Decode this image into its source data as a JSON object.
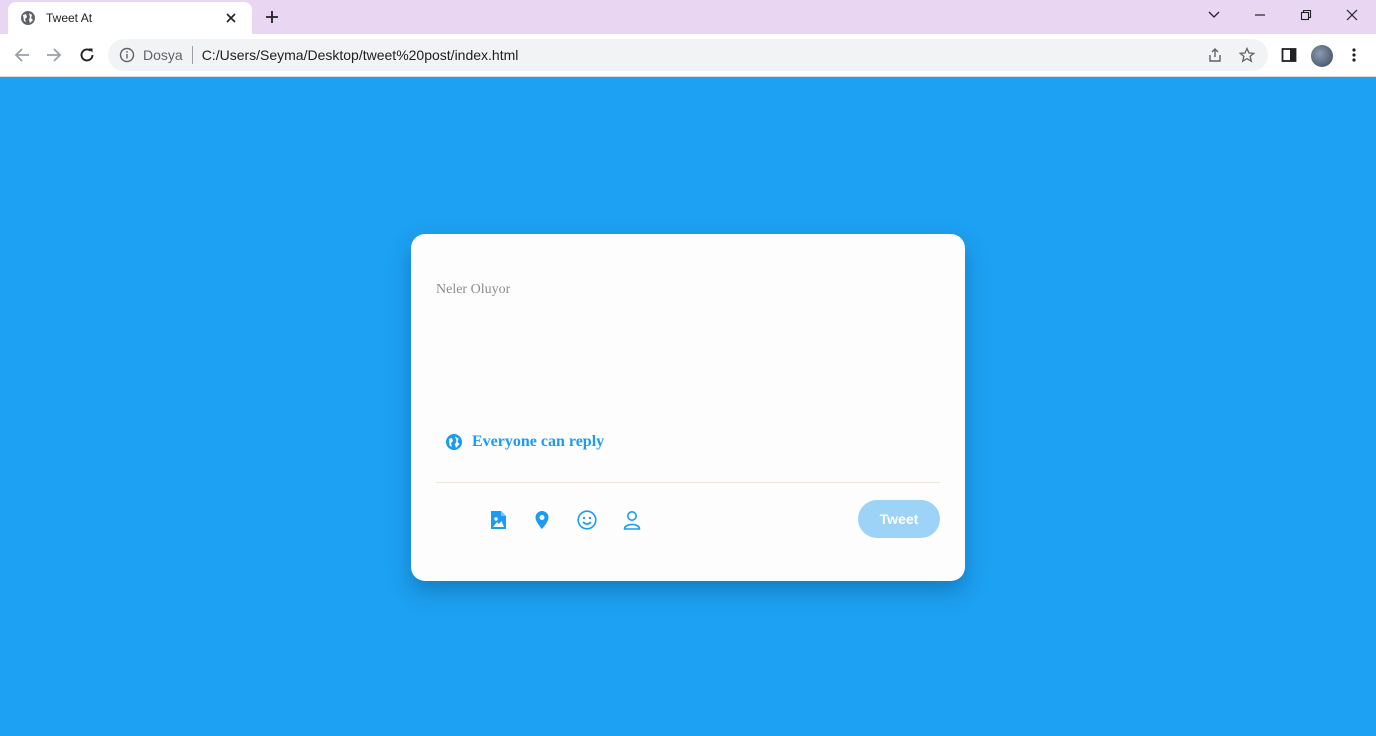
{
  "browser": {
    "tab_title": "Tweet At",
    "scheme_label": "Dosya",
    "url": "C:/Users/Seyma/Desktop/tweet%20post/index.html"
  },
  "composer": {
    "placeholder": "Neler Oluyor",
    "reply_setting": "Everyone can reply",
    "tools": [
      "image-icon",
      "location-icon",
      "emoji-icon",
      "user-icon"
    ],
    "tweet_label": "Tweet"
  },
  "colors": {
    "page_background": "#1da1f2",
    "accent": "#1d9bf0",
    "tweet_button_disabled": "#9cd3f6"
  }
}
